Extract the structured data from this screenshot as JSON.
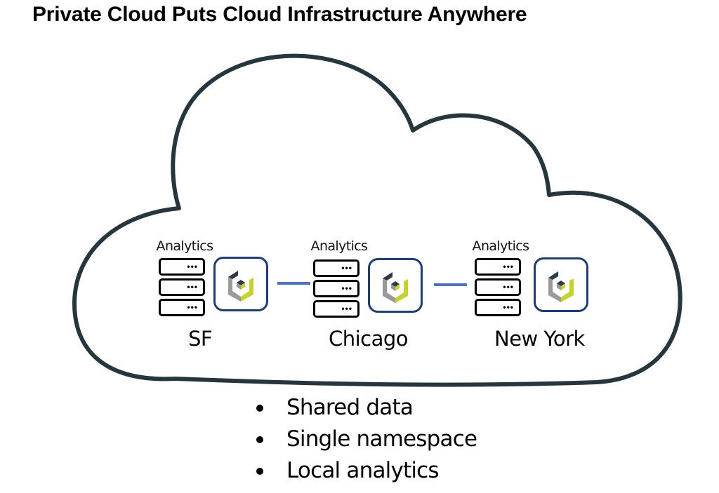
{
  "title": "Private Cloud Puts Cloud Infrastructure Anywhere",
  "colors": {
    "cloud_stroke": "#27353d",
    "logo_border": "#1f3d6e",
    "link_line": "#4f72c0",
    "logo_dark": "#2e3b47",
    "logo_gray": "#9a9a9a",
    "logo_green": "#c6d134"
  },
  "sites": [
    {
      "analytics_label": "Analytics",
      "city": "SF",
      "server_icon": "server-rack-icon",
      "logo_icon": "storage-cube-logo-icon"
    },
    {
      "analytics_label": "Analytics",
      "city": "Chicago",
      "server_icon": "server-rack-icon",
      "logo_icon": "storage-cube-logo-icon"
    },
    {
      "analytics_label": "Analytics",
      "city": "New York",
      "server_icon": "server-rack-icon",
      "logo_icon": "storage-cube-logo-icon"
    }
  ],
  "server_dots": "•••",
  "bullets": [
    "Shared data",
    "Single namespace",
    "Local analytics"
  ]
}
